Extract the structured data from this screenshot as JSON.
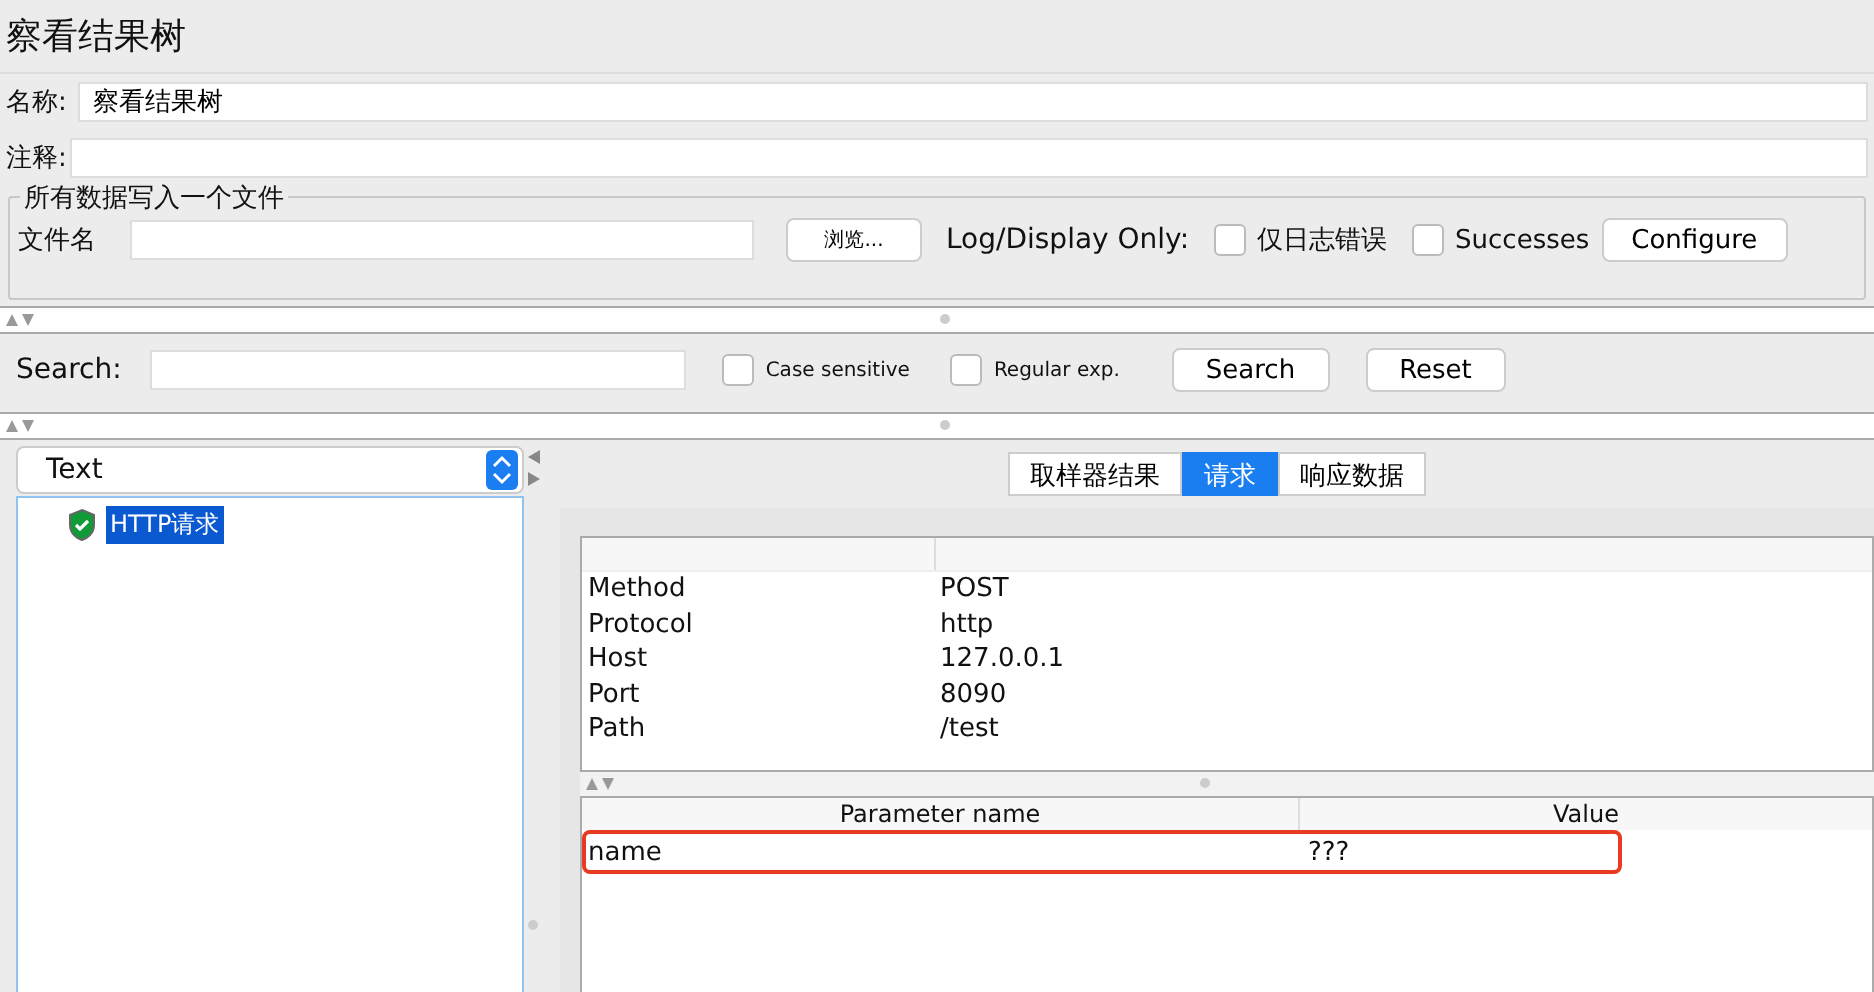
{
  "window": {
    "title": "察看结果树"
  },
  "name_field": {
    "label": "名称:",
    "value": "察看结果树"
  },
  "comment_field": {
    "label": "注释:"
  },
  "file_group": {
    "title": "所有数据写入一个文件",
    "filename_label": "文件名",
    "browse_button": "浏览...",
    "log_label": "Log/Display Only:",
    "checkboxes": [
      {
        "label": "仅日志错误",
        "checked": false
      },
      {
        "label": "Successes",
        "checked": false
      }
    ],
    "configure_button": "Configure"
  },
  "search": {
    "label": "Search:",
    "options": [
      {
        "label": "Case sensitive",
        "checked": false
      },
      {
        "label": "Regular exp.",
        "checked": false
      }
    ],
    "search_button": "Search",
    "reset_button": "Reset"
  },
  "renderer": {
    "value": "Text"
  },
  "tree": [
    {
      "label": "HTTP请求",
      "selected": true
    }
  ],
  "tabs": [
    {
      "label": "取样器结果",
      "selected": false
    },
    {
      "label": "请求",
      "selected": true
    },
    {
      "label": "响应数据",
      "selected": false
    }
  ],
  "request_rows": [
    {
      "name": "Method",
      "value": "POST"
    },
    {
      "name": "Protocol",
      "value": "http"
    },
    {
      "name": "Host",
      "value": "127.0.0.1"
    },
    {
      "name": "Port",
      "value": "8090"
    },
    {
      "name": "Path",
      "value": "/test"
    }
  ],
  "parameters": {
    "columns": [
      "Parameter name",
      "Value"
    ],
    "rows": [
      {
        "name": "name",
        "value": "???",
        "highlighted": true
      }
    ]
  }
}
